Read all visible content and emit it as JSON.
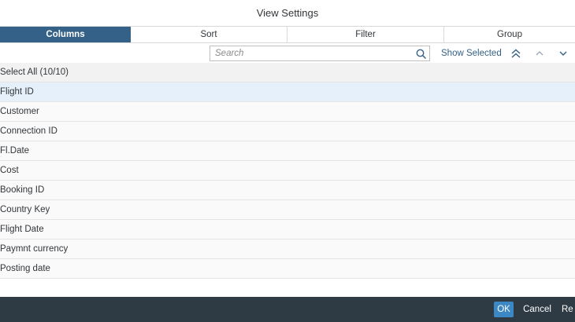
{
  "dialog": {
    "title": "View Settings"
  },
  "tabs": [
    {
      "label": "Columns",
      "active": true
    },
    {
      "label": "Sort",
      "active": false
    },
    {
      "label": "Filter",
      "active": false
    },
    {
      "label": "Group",
      "active": false
    }
  ],
  "toolbar": {
    "search_placeholder": "Search",
    "search_value": "",
    "show_selected_label": "Show Selected",
    "icons": [
      "double-chevron-up-icon",
      "chevron-up-icon",
      "chevron-down-icon"
    ]
  },
  "list": {
    "select_all_label": "Select All (10/10)",
    "items": [
      {
        "label": "Flight ID",
        "selected": true
      },
      {
        "label": "Customer",
        "selected": false
      },
      {
        "label": "Connection ID",
        "selected": false
      },
      {
        "label": "Fl.Date",
        "selected": false
      },
      {
        "label": "Cost",
        "selected": false
      },
      {
        "label": "Booking ID",
        "selected": false
      },
      {
        "label": "Country Key",
        "selected": false
      },
      {
        "label": "Flight Date",
        "selected": false
      },
      {
        "label": "Paymnt currency",
        "selected": false
      },
      {
        "label": "Posting date",
        "selected": false
      }
    ]
  },
  "footer": {
    "ok_label": "OK",
    "cancel_label": "Cancel",
    "reset_label": "Re"
  },
  "colors": {
    "active_tab": "#346187",
    "ok_button": "#3b88c4",
    "footer_bg": "#2e3a44",
    "selected_row": "#e5f0fa",
    "link": "#346187"
  }
}
